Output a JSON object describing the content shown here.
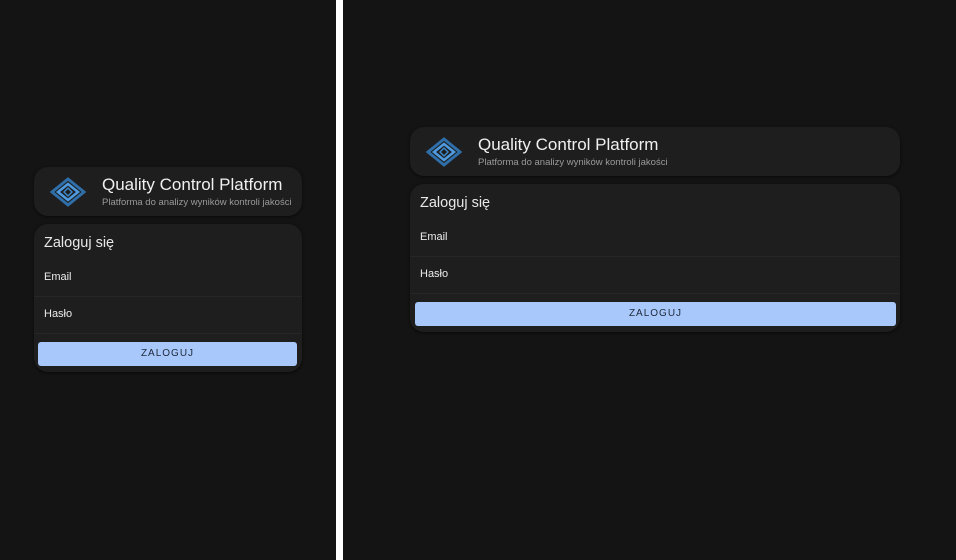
{
  "app": {
    "title": "Quality Control Platform",
    "subtitle": "Platforma do analizy wyników kontroli jakości",
    "logo_icon": "quality-diamond-logo-icon"
  },
  "login": {
    "heading": "Zaloguj się",
    "email_label": "Email",
    "password_label": "Hasło",
    "submit_label": "ZALOGUJ"
  },
  "colors": {
    "background": "#141414",
    "card": "#1e1e1e",
    "accent_button": "#a8c7fa",
    "logo_blue": "#3a86c8"
  }
}
